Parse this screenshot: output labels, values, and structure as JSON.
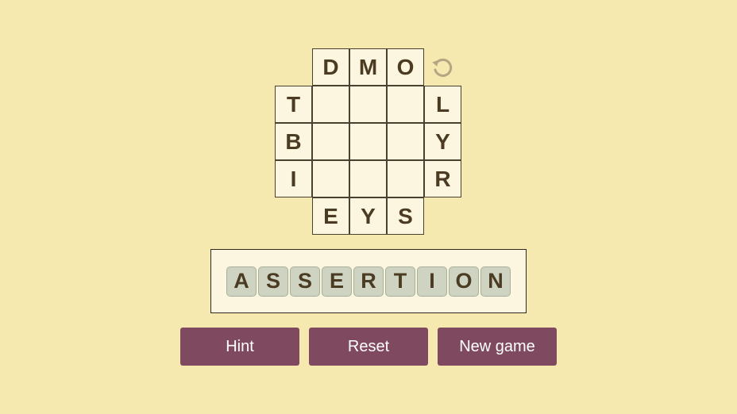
{
  "board": {
    "top": [
      "D",
      "M",
      "O"
    ],
    "left": [
      "T",
      "B",
      "I"
    ],
    "right": [
      "L",
      "Y",
      "R"
    ],
    "bottom": [
      "E",
      "Y",
      "S"
    ]
  },
  "undo_icon": "undo-icon",
  "current_word": [
    "A",
    "S",
    "S",
    "E",
    "R",
    "T",
    "I",
    "O",
    "N"
  ],
  "buttons": {
    "hint": "Hint",
    "reset": "Reset",
    "new_game": "New game"
  },
  "colors": {
    "background": "#f5e9b0",
    "cell": "#fcf5df",
    "tile": "#cfd3c1",
    "button": "#7f4a60",
    "text": "#4a3b22",
    "undo": "#b7a483"
  }
}
